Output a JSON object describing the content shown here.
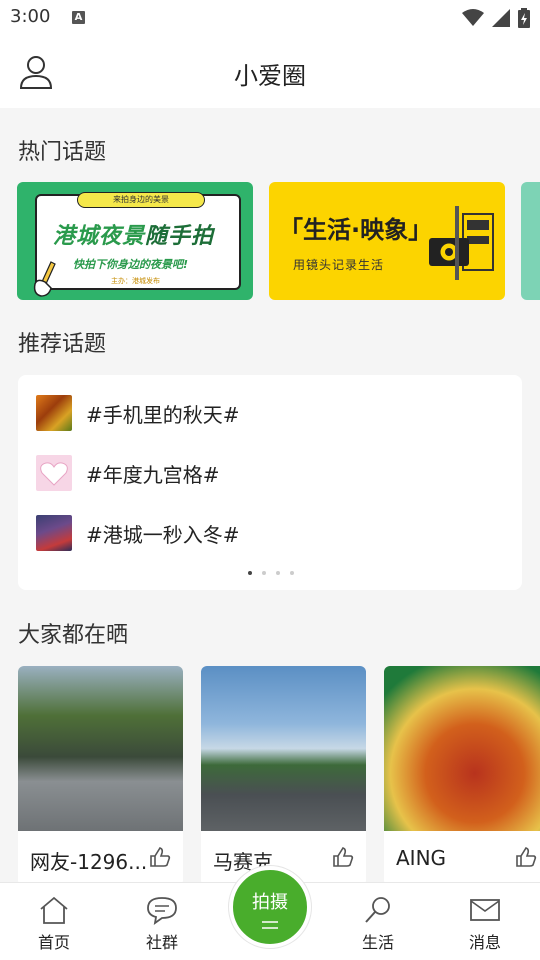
{
  "status_bar": {
    "time": "3:00",
    "notif": "A"
  },
  "header": {
    "title": "小爱圈"
  },
  "hot_topics": {
    "title": "热门话题",
    "banners": [
      {
        "top": "来拍身边的美景",
        "main_a": "港城夜景",
        "main_b": "随手拍",
        "sub": "快拍下你身边的夜景吧!",
        "note": "主办：港城发布"
      },
      {
        "main": "「生活·映象」",
        "sub": "用镜头记录生活"
      }
    ]
  },
  "recommended": {
    "title": "推荐话题",
    "items": [
      {
        "label": "#手机里的秋天#"
      },
      {
        "label": "#年度九宫格#"
      },
      {
        "label": "#港城一秒入冬#"
      }
    ]
  },
  "feed": {
    "title": "大家都在晒",
    "cards": [
      {
        "user": "网友-1296..."
      },
      {
        "user": "马赛克"
      },
      {
        "user": "AING"
      }
    ]
  },
  "tabbar": {
    "tabs": [
      {
        "label": "首页"
      },
      {
        "label": "社群"
      },
      {
        "label": "生活"
      },
      {
        "label": "消息"
      }
    ],
    "shoot": "拍摄"
  },
  "colors": {
    "accent_green": "#49ad2c",
    "banner_green": "#2fb36b",
    "banner_yellow": "#fcd400"
  }
}
